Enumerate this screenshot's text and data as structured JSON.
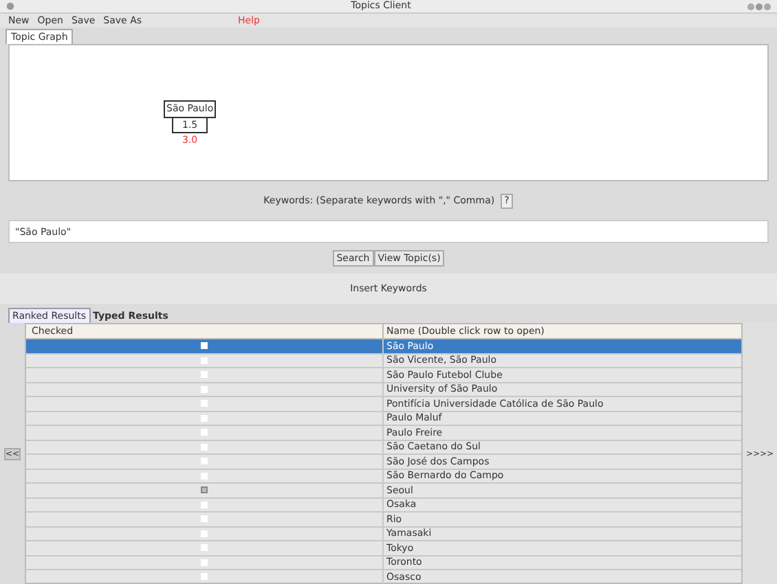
{
  "window": {
    "title": "Topics Client"
  },
  "menu": [
    "New",
    "Open",
    "Save",
    "Save As",
    "Help"
  ],
  "graph_tab": {
    "label": "Topic Graph",
    "selected": true
  },
  "graph_node": {
    "label": "São Paulo",
    "weight": "1.5",
    "score": "3.0"
  },
  "keywords": {
    "label": "Keywords: (Separate keywords with \",\" Comma)",
    "help": "?",
    "value": "\"São Paulo\""
  },
  "buttons": {
    "search": "Search",
    "view": "View Topic(s)",
    "insert": "Insert Keywords"
  },
  "result_tabs": [
    {
      "label": "Ranked Results",
      "selected": true
    },
    {
      "label": "Typed Results",
      "selected": false
    }
  ],
  "table": {
    "columns": [
      "Checked",
      "Name (Double click row to open)"
    ],
    "rows": [
      {
        "name": "São Paulo",
        "checked": false,
        "selected": true
      },
      {
        "name": "São Vicente, São Paulo",
        "checked": false,
        "selected": false
      },
      {
        "name": "São Paulo Futebol Clube",
        "checked": false,
        "selected": false
      },
      {
        "name": "University of São Paulo",
        "checked": false,
        "selected": false
      },
      {
        "name": "Pontifícia Universidade Católica de São Paulo",
        "checked": false,
        "selected": false
      },
      {
        "name": "Paulo Maluf",
        "checked": false,
        "selected": false
      },
      {
        "name": "Paulo Freire",
        "checked": false,
        "selected": false
      },
      {
        "name": "São Caetano do Sul",
        "checked": false,
        "selected": false
      },
      {
        "name": "São José dos Campos",
        "checked": false,
        "selected": false
      },
      {
        "name": "São Bernardo do Campo",
        "checked": false,
        "selected": false
      },
      {
        "name": "Seoul",
        "checked": true,
        "selected": false
      },
      {
        "name": "Osaka",
        "checked": false,
        "selected": false
      },
      {
        "name": "Rio",
        "checked": false,
        "selected": false
      },
      {
        "name": "Yamasaki",
        "checked": false,
        "selected": false
      },
      {
        "name": "Tokyo",
        "checked": false,
        "selected": false
      },
      {
        "name": "Toronto",
        "checked": false,
        "selected": false
      },
      {
        "name": "Osasco",
        "checked": false,
        "selected": false
      }
    ]
  },
  "prev_button": "<<",
  "next_button": ">>>>"
}
